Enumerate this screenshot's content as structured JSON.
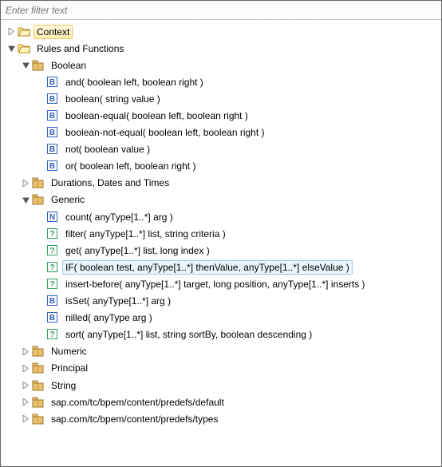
{
  "filter": {
    "placeholder": "Enter filter text"
  },
  "tree": {
    "context": {
      "label": "Context"
    },
    "rules": {
      "label": "Rules and Functions",
      "boolean": {
        "label": "Boolean",
        "items": [
          "and( boolean left, boolean right )",
          "boolean( string value )",
          "boolean-equal( boolean left, boolean right )",
          "boolean-not-equal( boolean left, boolean right )",
          "not( boolean value )",
          "or( boolean left, boolean right )"
        ]
      },
      "durations": {
        "label": "Durations, Dates and Times"
      },
      "generic": {
        "label": "Generic",
        "items": [
          "count( anyType[1..*] arg )",
          "filter( anyType[1..*] list, string criteria )",
          "get( anyType[1..*] list, long index )",
          "IF( boolean test, anyType[1..*] thenValue, anyType[1..*] elseValue )",
          "insert-before( anyType[1..*] target, long position, anyType[1..*] inserts )",
          "isSet( anyType[1..*] arg )",
          "nilled( anyType arg )",
          "sort( anyType[1..*] list, string sortBy, boolean descending )"
        ]
      },
      "numeric": {
        "label": "Numeric"
      },
      "principal": {
        "label": "Principal"
      },
      "string": {
        "label": "String"
      },
      "predefs_default": {
        "label": "sap.com/tc/bpem/content/predefs/default"
      },
      "predefs_types": {
        "label": "sap.com/tc/bpem/content/predefs/types"
      }
    }
  }
}
